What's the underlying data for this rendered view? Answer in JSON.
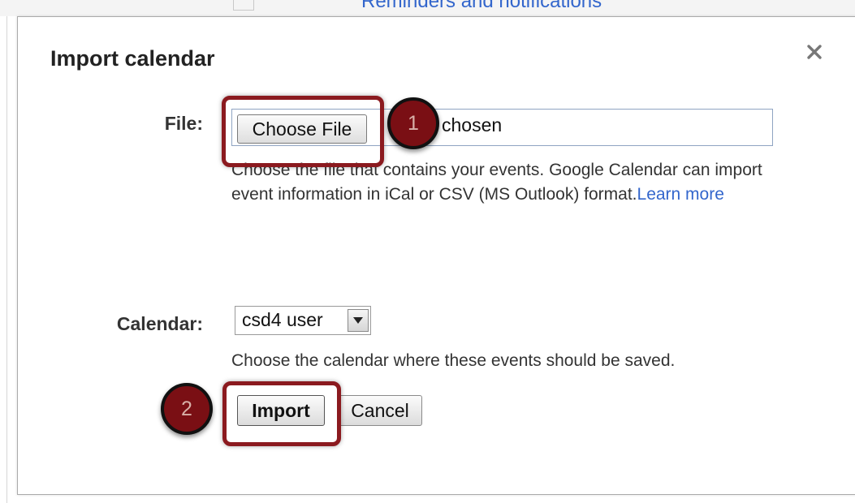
{
  "background": {
    "link_text": "Reminders and notifications"
  },
  "dialog": {
    "title": "Import calendar",
    "close_icon": "close-icon",
    "file": {
      "label": "File:",
      "button_label": "Choose File",
      "status_text": "chosen",
      "help_text": "Choose the file that contains your events. Google Calendar can import event information in iCal or CSV (MS Outlook) format.",
      "learn_more": "Learn more"
    },
    "calendar": {
      "label": "Calendar:",
      "selected_value": "csd4 user",
      "help_text": "Choose the calendar where these events should be saved."
    },
    "buttons": {
      "import_label": "Import",
      "cancel_label": "Cancel"
    }
  },
  "annotations": {
    "step_1": "1",
    "step_2": "2",
    "highlight_color": "#8b1a1f",
    "badge_color": "#7a0f14"
  },
  "colors": {
    "link": "#3366cc",
    "text": "#333333"
  }
}
